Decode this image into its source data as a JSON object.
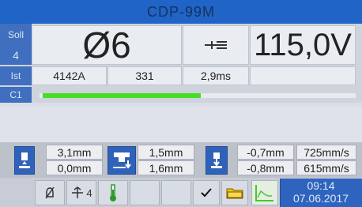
{
  "title": "CDP-99M",
  "panel": {
    "soll_label": "Soll",
    "soll_index": "4",
    "ist_label": "Ist",
    "c1_label": "C1",
    "diameter": "Ø6",
    "voltage": "115,0V",
    "ist_current": "4142A",
    "ist_value_2": "331",
    "ist_time": "2,9ms",
    "progress_fraction": 0.51
  },
  "params": {
    "p1_top": "3,1mm",
    "p1_bottom": "0,0mm",
    "p2_top": "1,5mm",
    "p2_bottom": "1,6mm",
    "p3_top": "-0,7mm",
    "p3_bottom": "-0,8mm",
    "p4_top": "725mm/s",
    "p4_bottom": "615mm/s"
  },
  "toolbar": {
    "mode_label": "4",
    "time": "09:14",
    "date": "07.06.2017"
  },
  "colors": {
    "header_blue": "#1f64c6",
    "side_blue": "#3f6fbe",
    "progress_green": "#47dc27",
    "folder_yellow": "#f2c200"
  }
}
